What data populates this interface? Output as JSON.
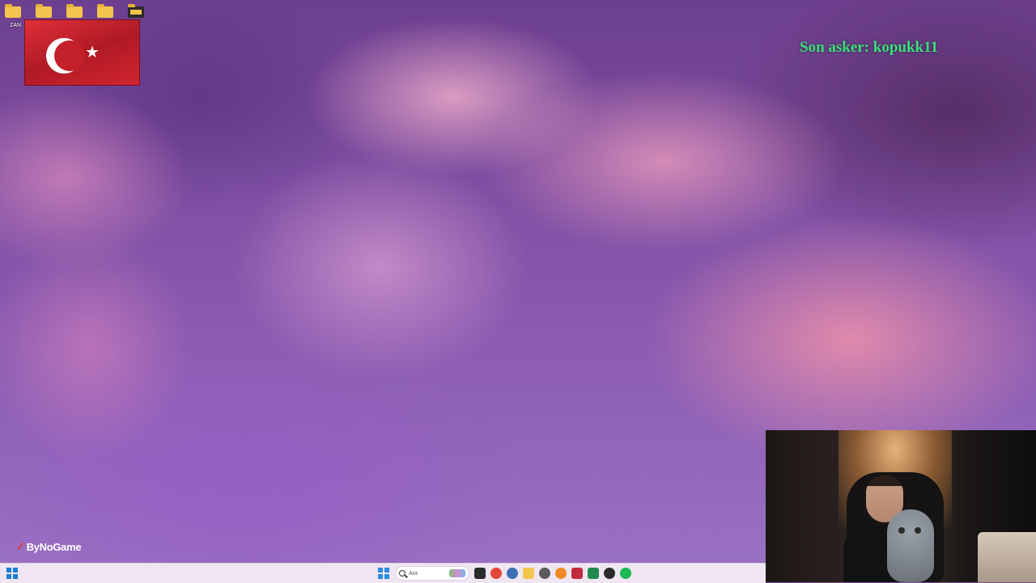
{
  "desktop": {
    "icons": [
      {
        "name": "folder-icon",
        "style": "folder"
      },
      {
        "name": "folder-icon",
        "style": "folder"
      },
      {
        "name": "folder-icon",
        "style": "folder"
      },
      {
        "name": "folder-icon",
        "style": "folder"
      },
      {
        "name": "folder-icon",
        "style": "folder-dark"
      }
    ],
    "first_icon_caption": "ZAN",
    "flag_image": "turkish-flag",
    "overlay_text": "Son asker: kopukk11",
    "overlay_color": "#39e07a",
    "brand_mark": "✓",
    "brand_name": "ByNoGame"
  },
  "webcam": {
    "content": "streamer-webcam"
  },
  "taskbar": {
    "left_icon": "widgets-icon",
    "search_placeholder": "Ara",
    "pinned_apps": [
      {
        "name": "file-explorer-icon",
        "color": "#2b2b2b"
      },
      {
        "name": "chrome-icon",
        "color": "#e8453c"
      },
      {
        "name": "steam-icon",
        "color": "#3d6fb5"
      },
      {
        "name": "folder-icon",
        "color": "#f3c54d"
      },
      {
        "name": "app-icon",
        "color": "#5b5b5b"
      },
      {
        "name": "browser-icon",
        "color": "#f08a24"
      },
      {
        "name": "media-icon",
        "color": "#c02a3e"
      },
      {
        "name": "excel-icon",
        "color": "#1f8a4c"
      },
      {
        "name": "obs-icon",
        "color": "#2a2a2a"
      },
      {
        "name": "spotify-icon",
        "color": "#1db954"
      }
    ]
  }
}
